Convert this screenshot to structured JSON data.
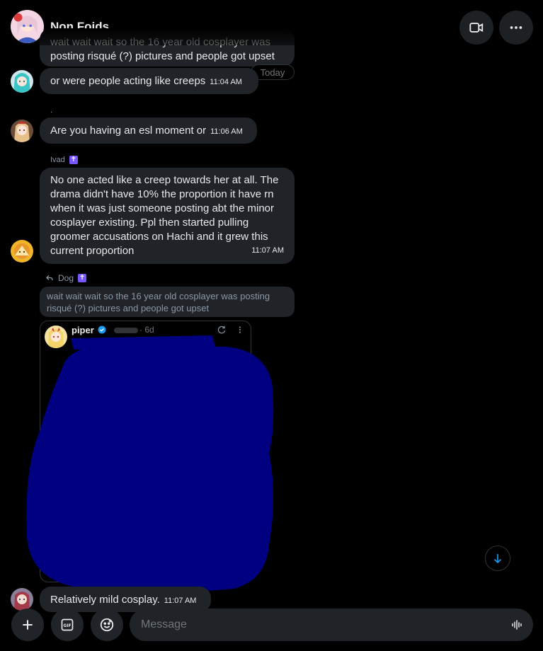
{
  "header": {
    "title": "Non Foids",
    "icons": {
      "video": "video-call-icon",
      "more": "more-options-icon"
    }
  },
  "divider": {
    "today": "Today"
  },
  "messages": [
    {
      "text": "wait wait wait so the 16 year old cosplayer was posting risqué (?) pictures and people got upset",
      "time": ""
    },
    {
      "text": "or were people acting like creeps",
      "time": "11:04 AM"
    },
    {
      "sender": ".",
      "text": "Are you having an esl moment or",
      "time": "11:06 AM"
    },
    {
      "sender": "Ivad",
      "text": "No one acted like a creep towards her at all. The drama didn't have 10% the proportion it have rn when it was just someone posting abt the minor cosplayer existing. Ppl then started pulling groomer accusations on Hachi and it grew this current proportion",
      "time": "11:07 AM"
    },
    {
      "text": "Relatively mild cosplay.",
      "time": "11:07 AM"
    }
  ],
  "reply": {
    "to": "Dog",
    "quoted": "wait wait wait so the 16 year old cosplayer was posting risqué (?) pictures and people got upset"
  },
  "embed": {
    "author": "piper",
    "age": "· 6d"
  },
  "composer": {
    "placeholder": "Message"
  },
  "colors": {
    "accent": "#1d9bf0",
    "bubble": "#202327",
    "badge": "#7856ff",
    "redaction": "#000080"
  }
}
